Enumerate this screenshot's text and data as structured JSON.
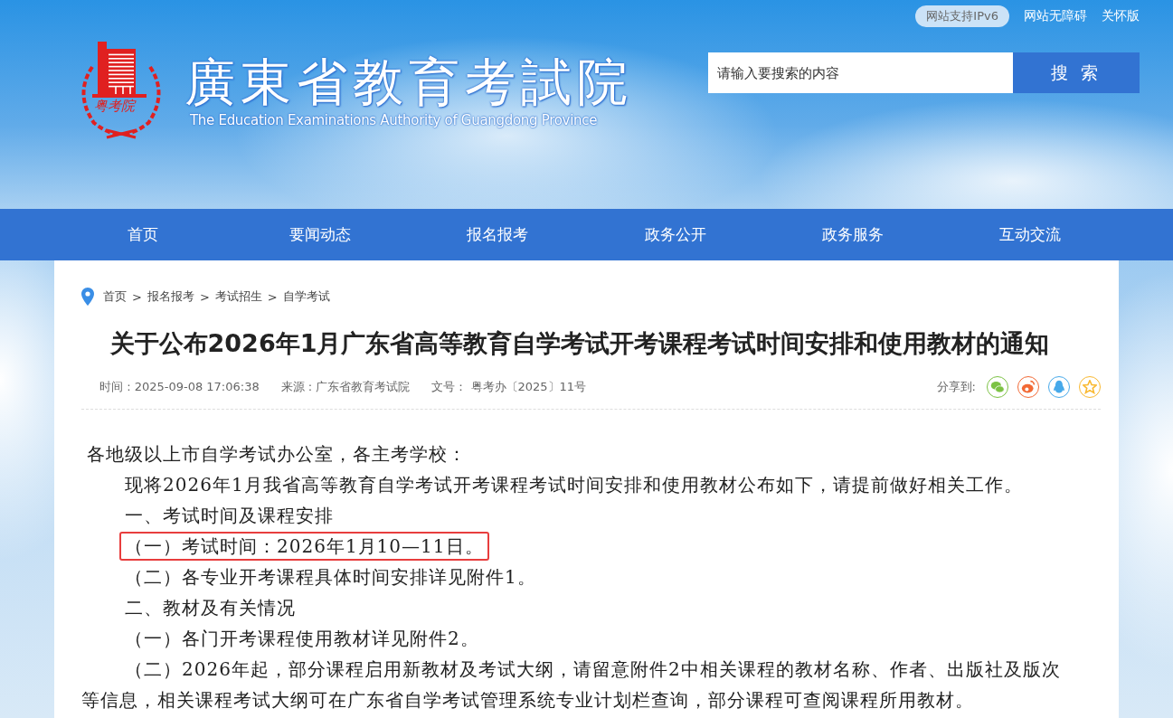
{
  "top_links": [
    {
      "label": "网站支持IPv6",
      "kind": "pill"
    },
    {
      "label": "网站无障碍",
      "kind": "link"
    },
    {
      "label": "关怀版",
      "kind": "link"
    }
  ],
  "logo": {
    "emblem_text": "粤考院",
    "title": "廣東省教育考試院",
    "subtitle": "The Education Examinations Authority of Guangdong Province"
  },
  "search": {
    "placeholder": "请输入要搜索的内容",
    "button": "搜 索"
  },
  "nav": [
    "首页",
    "要闻动态",
    "报名报考",
    "政务公开",
    "政务服务",
    "互动交流"
  ],
  "breadcrumb": [
    "首页",
    "报名报考",
    "考试招生",
    "自学考试"
  ],
  "breadcrumb_separator": ">",
  "article": {
    "title": "关于公布2026年1月广东省高等教育自学考试开考课程考试时间安排和使用教材的通知",
    "meta": [
      "时间 : 2025-09-08 17:06:38",
      "来源 : 广东省教育考试院",
      "文号： 粤考办〔2025〕11号"
    ],
    "share_label": "分享到:",
    "share": [
      {
        "kind": "chat",
        "color": "#7cc244"
      },
      {
        "kind": "swirl",
        "color": "#f26a36"
      },
      {
        "kind": "penguin",
        "color": "#47a9ea"
      },
      {
        "kind": "star",
        "color": "#f9b82f"
      }
    ],
    "paragraphs": [
      {
        "text": "各地级以上市自学考试办公室，各主考学校：",
        "kind": "plain",
        "highlighted": false
      },
      {
        "text": "现将2026年1月我省高等教育自学考试开考课程考试时间安排和使用教材公布如下，请提前做好相关工作。",
        "kind": "indent",
        "highlighted": false
      },
      {
        "text": "一、考试时间及课程安排",
        "kind": "indent",
        "highlighted": false
      },
      {
        "text": "（一）考试时间：2026年1月10—11日。",
        "kind": "indent",
        "highlighted": true
      },
      {
        "text": "（二）各专业开考课程具体时间安排详见附件1。",
        "kind": "indent",
        "highlighted": false
      },
      {
        "text": "二、教材及有关情况",
        "kind": "indent",
        "highlighted": false
      },
      {
        "text": "（一）各门开考课程使用教材详见附件2。",
        "kind": "indent",
        "highlighted": false
      },
      {
        "text": "（二）2026年起，部分课程启用新教材及考试大纲，请留意附件2中相关课程的教材名称、作者、出版社及版次等信息，相关课程考试大纲可在广东省自学考试管理系统专业计划栏查询，部分课程可查阅课程所用教材。",
        "kind": "indent",
        "highlighted": false
      }
    ]
  }
}
